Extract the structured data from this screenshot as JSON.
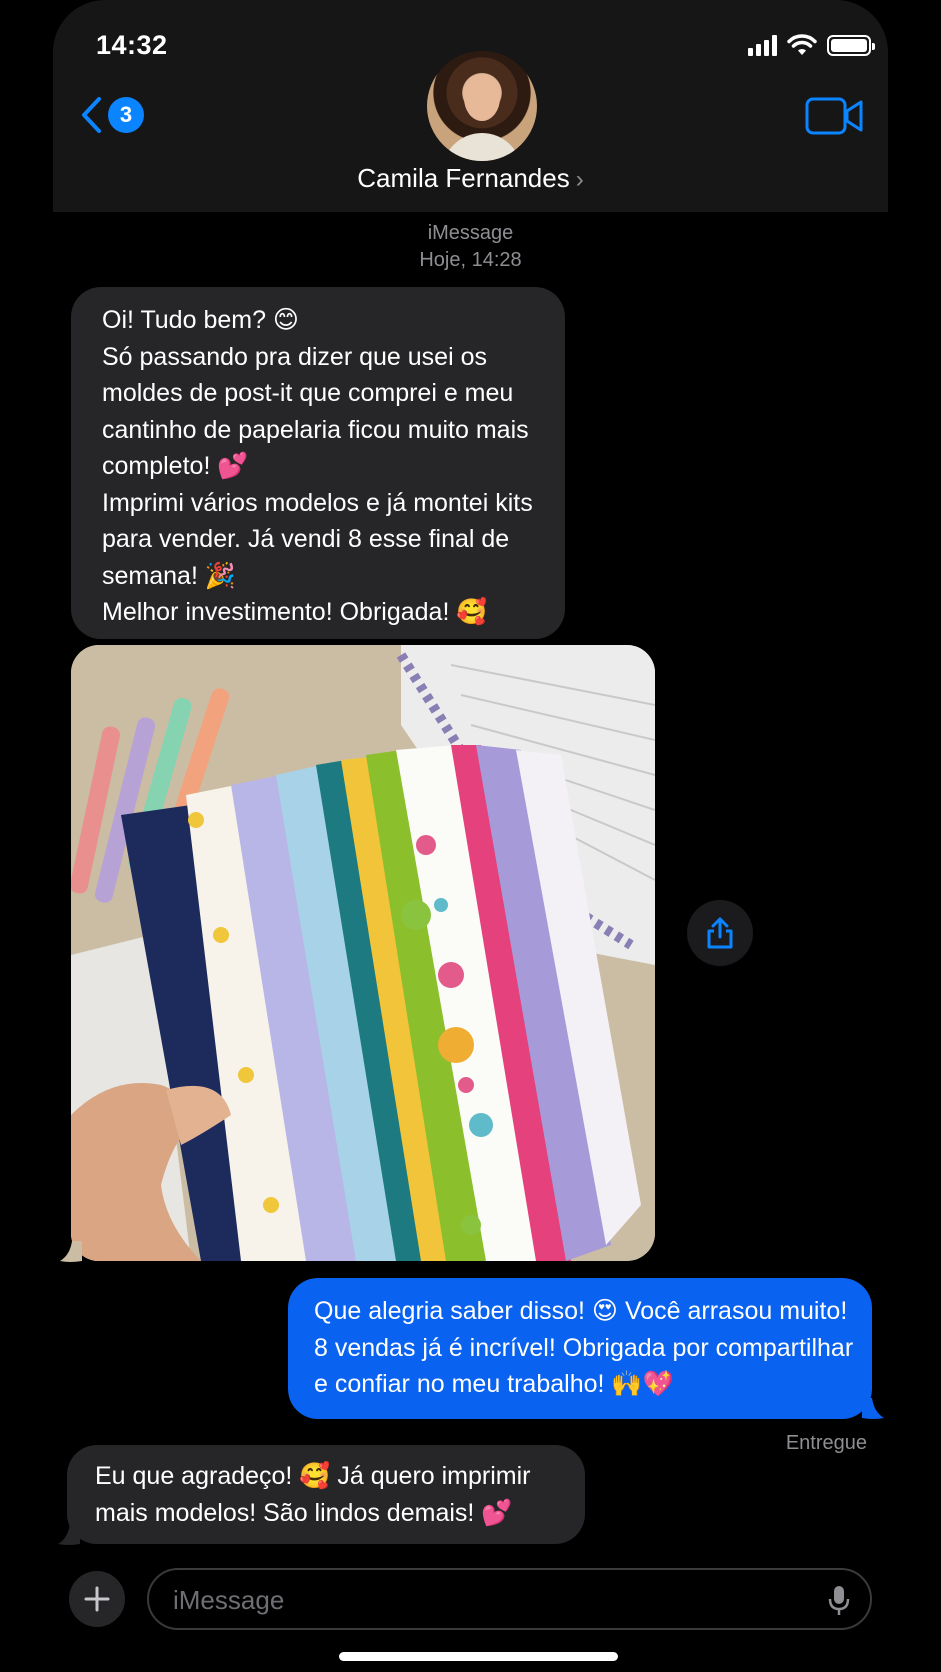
{
  "status_bar": {
    "time": "14:32"
  },
  "header": {
    "back_badge": "3",
    "contact_name": "Camila Fernandes",
    "contact_chevron": "›"
  },
  "thread_meta": {
    "service": "iMessage",
    "timestamp": "Hoje, 14:28"
  },
  "messages": [
    {
      "direction": "incoming",
      "text": "Oi! Tudo bem? 😊\nSó passando pra dizer que usei os moldes de post-it que comprei e meu cantinho de papelaria ficou muito mais completo! 💕\nImprimi vários modelos e já montei kits para vender. Já vendi 8 esse final de semana! 🎉\nMelhor investimento! Obrigada! 🥰"
    },
    {
      "direction": "outgoing",
      "text": "Que alegria saber disso! 😍 Você arrasou muito! 8 vendas já é incrível! Obrigada por compartilhar e confiar no meu trabalho! 🙌💖"
    },
    {
      "direction": "incoming",
      "text": "Eu que agradeço! 🥰 Já quero imprimir mais modelos! São lindos demais! 💕"
    }
  ],
  "delivery_status": "Entregue",
  "compose": {
    "placeholder": "iMessage"
  },
  "icons": {
    "back": "chevron-left-icon",
    "video": "video-camera-icon",
    "share": "share-icon",
    "plus": "plus-icon",
    "mic": "microphone-icon"
  },
  "colors": {
    "accent": "#0a84ff",
    "outgoing_bubble": "#0a63f0",
    "incoming_bubble": "#262628"
  }
}
